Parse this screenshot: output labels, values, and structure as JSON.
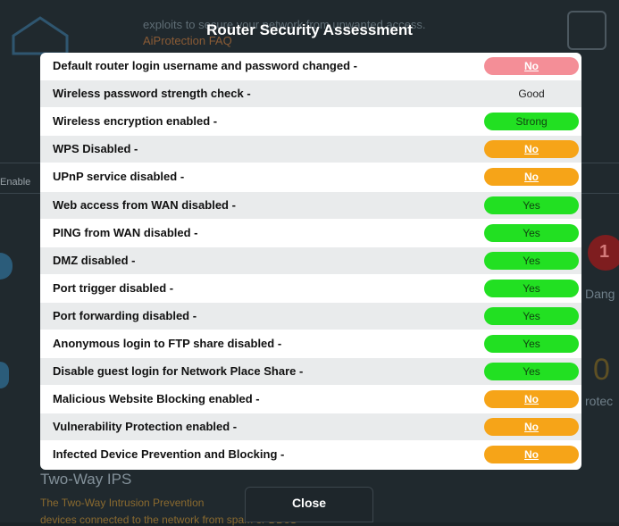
{
  "background": {
    "text1": "exploits to secure your network from unwanted access.",
    "text2": "AiProtection FAQ",
    "text3": "Enable",
    "text4": "Dang",
    "text5": "rotec",
    "text6": "Two-Way IPS",
    "text7": "The Two-Way Intrusion Prevention",
    "text8": "devices connected to the network from spam or DDoS",
    "badge_number": "1",
    "gold_number": "0"
  },
  "modal": {
    "title": "Router Security Assessment",
    "close_label": "Close",
    "rows": [
      {
        "label": "Default router login username and password changed -",
        "value": "No",
        "status": "pink"
      },
      {
        "label": "Wireless password strength check -",
        "value": "Good",
        "status": "plain"
      },
      {
        "label": "Wireless encryption enabled -",
        "value": "Strong",
        "status": "green"
      },
      {
        "label": "WPS Disabled -",
        "value": "No",
        "status": "orange"
      },
      {
        "label": "UPnP service disabled -",
        "value": "No",
        "status": "orange"
      },
      {
        "label": "Web access from WAN disabled -",
        "value": "Yes",
        "status": "green"
      },
      {
        "label": "PING from WAN disabled -",
        "value": "Yes",
        "status": "green"
      },
      {
        "label": "DMZ disabled -",
        "value": "Yes",
        "status": "green"
      },
      {
        "label": "Port trigger disabled -",
        "value": "Yes",
        "status": "green"
      },
      {
        "label": "Port forwarding disabled -",
        "value": "Yes",
        "status": "green"
      },
      {
        "label": "Anonymous login to FTP share disabled -",
        "value": "Yes",
        "status": "green"
      },
      {
        "label": "Disable guest login for Network Place Share -",
        "value": "Yes",
        "status": "green"
      },
      {
        "label": "Malicious Website Blocking enabled -",
        "value": "No",
        "status": "orange"
      },
      {
        "label": "Vulnerability Protection enabled -",
        "value": "No",
        "status": "orange"
      },
      {
        "label": "Infected Device Prevention and Blocking -",
        "value": "No",
        "status": "orange"
      }
    ]
  },
  "colors": {
    "green": "#22e022",
    "orange": "#f6a418",
    "pink": "#f48e97"
  }
}
